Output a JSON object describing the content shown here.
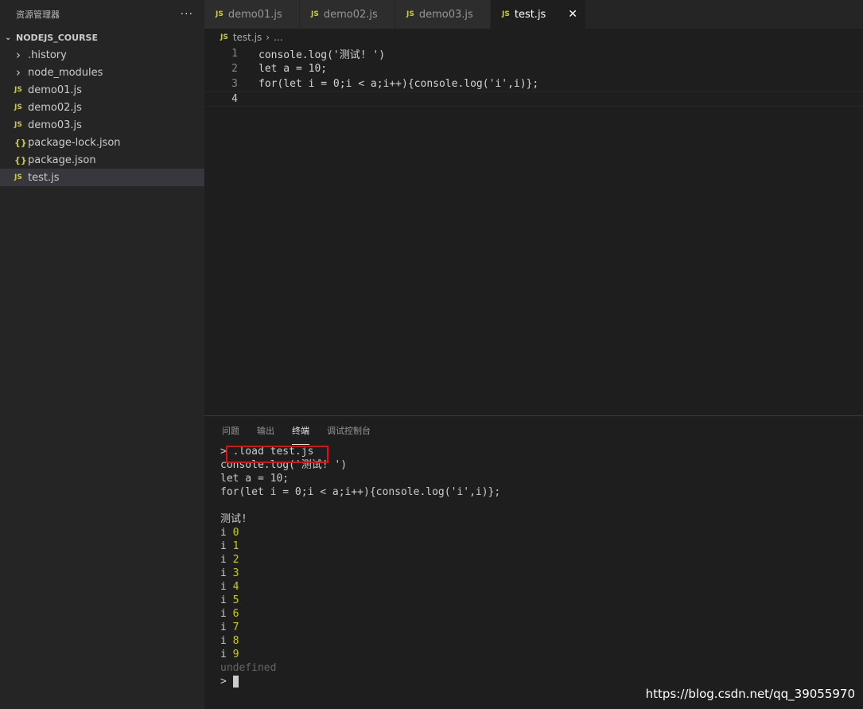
{
  "sidebar": {
    "title": "资源管理器",
    "more": "···",
    "folder": "NODEJS_COURSE",
    "items": [
      {
        "icon": "chevron-right",
        "label": ".history",
        "type": "folder"
      },
      {
        "icon": "chevron-right",
        "label": "node_modules",
        "type": "folder"
      },
      {
        "icon": "JS",
        "label": "demo01.js",
        "type": "js"
      },
      {
        "icon": "JS",
        "label": "demo02.js",
        "type": "js"
      },
      {
        "icon": "JS",
        "label": "demo03.js",
        "type": "js"
      },
      {
        "icon": "{}",
        "label": "package-lock.json",
        "type": "json"
      },
      {
        "icon": "{}",
        "label": "package.json",
        "type": "json"
      },
      {
        "icon": "JS",
        "label": "test.js",
        "type": "js"
      }
    ]
  },
  "tabs": [
    {
      "label": "demo01.js"
    },
    {
      "label": "demo02.js"
    },
    {
      "label": "demo03.js"
    },
    {
      "label": "test.js",
      "active": true
    }
  ],
  "tab_icon": "JS",
  "tab_close": "✕",
  "breadcrumb": {
    "file": "test.js",
    "sep": "›",
    "rest": "..."
  },
  "editor": {
    "lines": [
      {
        "n": "1",
        "code": "console.log('测试! ')"
      },
      {
        "n": "2",
        "code": "let a = 10;"
      },
      {
        "n": "3",
        "code": "for(let i = 0;i < a;i++){console.log('i',i)};"
      },
      {
        "n": "4",
        "code": ""
      }
    ]
  },
  "panel": {
    "tabs": [
      "问题",
      "输出",
      "终端",
      "调试控制台"
    ],
    "active_tab": "终端"
  },
  "terminal": {
    "prompt": ">",
    "command": " .load test.js",
    "echo": [
      "console.log('测试! ')",
      "let a = 10;",
      "for(let i = 0;i < a;i++){console.log('i',i)};",
      ""
    ],
    "output_first": "测试!",
    "loop_label": "i",
    "loop_values": [
      "0",
      "1",
      "2",
      "3",
      "4",
      "5",
      "6",
      "7",
      "8",
      "9"
    ],
    "result": "undefined"
  },
  "watermark": "https://blog.csdn.net/qq_39055970",
  "colors": {
    "js_icon": "#cbcb41",
    "number": "#cdcd00",
    "highlight_box": "#e01010"
  }
}
